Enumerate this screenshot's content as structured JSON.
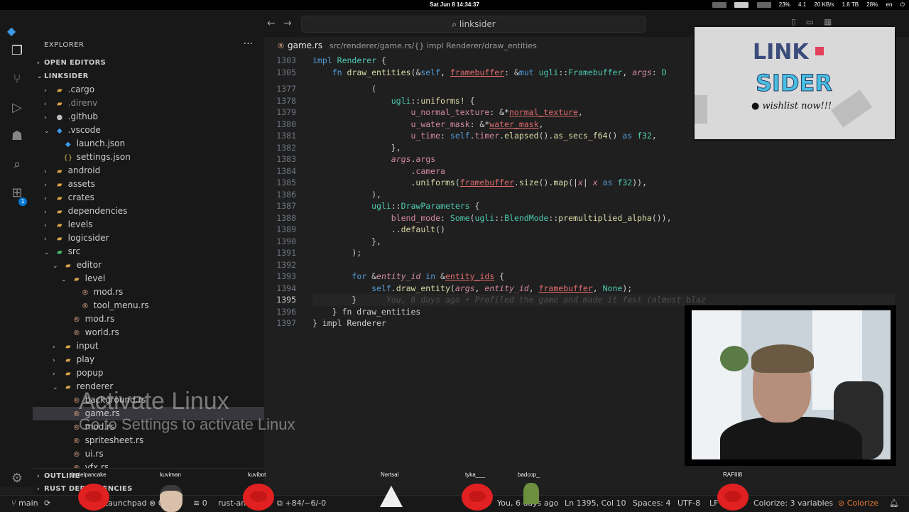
{
  "system_bar": {
    "clock": "Sat Jun 8 14:34:37",
    "tray": [
      "23%",
      "4.1",
      "20 KB/s",
      "1.8 TB",
      "28%",
      "en"
    ]
  },
  "titlebar": {
    "back_label": "←",
    "forward_label": "→",
    "search_text": "linksider"
  },
  "activity_bar": {
    "badge_count": "1"
  },
  "sidebar": {
    "header": "EXPLORER",
    "more": "···",
    "open_editors": "OPEN EDITORS",
    "project": "LINKSIDER",
    "items": [
      {
        "label": ".cargo",
        "type": "folder",
        "chev": "›",
        "indent": 0
      },
      {
        "label": ".direnv",
        "type": "folder",
        "chev": "›",
        "indent": 0,
        "dim": true
      },
      {
        "label": ".github",
        "type": "gh",
        "chev": "›",
        "indent": 0
      },
      {
        "label": ".vscode",
        "type": "vs",
        "chev": "⌄",
        "indent": 0
      },
      {
        "label": "launch.json",
        "type": "vs",
        "chev": "",
        "indent": 1
      },
      {
        "label": "settings.json",
        "type": "json",
        "chev": "",
        "indent": 1
      },
      {
        "label": "android",
        "type": "folder",
        "chev": "›",
        "indent": 0
      },
      {
        "label": "assets",
        "type": "folder",
        "chev": "›",
        "indent": 0
      },
      {
        "label": "crates",
        "type": "folder",
        "chev": "›",
        "indent": 0
      },
      {
        "label": "dependencies",
        "type": "folder",
        "chev": "›",
        "indent": 0
      },
      {
        "label": "levels",
        "type": "folder",
        "chev": "›",
        "indent": 0
      },
      {
        "label": "logicsider",
        "type": "folder",
        "chev": "›",
        "indent": 0
      },
      {
        "label": "src",
        "type": "src",
        "chev": "⌄",
        "indent": 0
      },
      {
        "label": "editor",
        "type": "folder",
        "chev": "⌄",
        "indent": 1
      },
      {
        "label": "level",
        "type": "folder",
        "chev": "⌄",
        "indent": 2
      },
      {
        "label": "mod.rs",
        "type": "rs",
        "chev": "",
        "indent": 3
      },
      {
        "label": "tool_menu.rs",
        "type": "rs",
        "chev": "",
        "indent": 3
      },
      {
        "label": "mod.rs",
        "type": "rs",
        "chev": "",
        "indent": 2
      },
      {
        "label": "world.rs",
        "type": "rs",
        "chev": "",
        "indent": 2
      },
      {
        "label": "input",
        "type": "folder",
        "chev": "›",
        "indent": 1
      },
      {
        "label": "play",
        "type": "folder",
        "chev": "›",
        "indent": 1
      },
      {
        "label": "popup",
        "type": "folder",
        "chev": "›",
        "indent": 1
      },
      {
        "label": "renderer",
        "type": "folder",
        "chev": "⌄",
        "indent": 1
      },
      {
        "label": "background.rs",
        "type": "rs",
        "chev": "",
        "indent": 2
      },
      {
        "label": "game.rs",
        "type": "rs",
        "chev": "",
        "indent": 2,
        "selected": true
      },
      {
        "label": "mod.rs",
        "type": "rs",
        "chev": "",
        "indent": 2
      },
      {
        "label": "spritesheet.rs",
        "type": "rs",
        "chev": "",
        "indent": 2
      },
      {
        "label": "ui.rs",
        "type": "rs",
        "chev": "",
        "indent": 2
      },
      {
        "label": "vfx.rs",
        "type": "rs",
        "chev": "",
        "indent": 2
      }
    ],
    "outline": "OUTLINE",
    "rust_deps": "RUST DEPENDENCIES"
  },
  "editor": {
    "tab_name": "game.rs",
    "breadcrumb": [
      "src/renderer/game.rs/",
      "{} impl Renderer/",
      "draw_entities"
    ],
    "lines": [
      {
        "n": "1303",
        "html": "<span class='kw'>impl</span> <span class='ty'>Renderer</span> {"
      },
      {
        "n": "1305",
        "html": "    <span class='kw'>fn</span> <span class='fn'>draw_entities</span>(&amp;<span class='kw'>self</span>, <span class='vr'>framebuffer</span>: &amp;<span class='kw'>mut</span> <span class='ty'>ugli</span>::<span class='ty'>Framebuffer</span>, <span class='it'>args</span>: <span class='ty'>D</span>"
      },
      {
        "n": "1377",
        "html": "            ("
      },
      {
        "n": "1378",
        "html": "                <span class='ty'>ugli</span>::<span class='fn'>uniforms!</span> {"
      },
      {
        "n": "1379",
        "html": "                    <span class='pr'>u_normal_texture</span>: &amp;*<span class='vr'>normal_texture</span>,"
      },
      {
        "n": "1380",
        "html": "                    <span class='pr'>u_water_mask</span>: &amp;*<span class='vr'>water_mask</span>,"
      },
      {
        "n": "1381",
        "html": "                    <span class='pr'>u_time</span>: <span class='kw'>self</span>.<span class='pr'>timer</span>.<span class='fn'>elapsed</span>().<span class='fn'>as_secs_f64</span>() <span class='kw'>as</span> <span class='ty'>f32</span>,"
      },
      {
        "n": "1382",
        "html": "                },"
      },
      {
        "n": "1383",
        "html": "                <span class='it'>args</span>.<span class='pr'>args</span>"
      },
      {
        "n": "1384",
        "html": "                    .<span class='pr'>camera</span>"
      },
      {
        "n": "1385",
        "html": "                    .<span class='fn'>uniforms</span>(<span class='vr'>framebuffer</span>.<span class='fn'>size</span>().<span class='fn'>map</span>(|<span class='it'>x</span>| <span class='it'>x</span> <span class='kw'>as</span> <span class='ty'>f32</span>)),"
      },
      {
        "n": "1386",
        "html": "            ),"
      },
      {
        "n": "1387",
        "html": "            <span class='ty'>ugli</span>::<span class='ty'>DrawParameters</span> {"
      },
      {
        "n": "1388",
        "html": "                <span class='pr'>blend_mode</span>: <span class='ty'>Some</span>(<span class='ty'>ugli</span>::<span class='ty'>BlendMode</span>::<span class='fn'>premultiplied_alpha</span>()),"
      },
      {
        "n": "1389",
        "html": "                ..<span class='fn'>default</span>()"
      },
      {
        "n": "1390",
        "html": "            },"
      },
      {
        "n": "1391",
        "html": "        );"
      },
      {
        "n": "1392",
        "html": ""
      },
      {
        "n": "1393",
        "html": "        <span class='kw'>for</span> &amp;<span class='it'>entity_id</span> <span class='kw'>in</span> &amp;<span class='vr'>entity_ids</span> {"
      },
      {
        "n": "1394",
        "html": "            <span class='kw'>self</span>.<span class='fn'>draw_entity</span>(<span class='it'>args</span>, <span class='it'>entity_id</span>, <span class='vr'>framebuffer</span>, <span class='ty'>None</span>);"
      },
      {
        "n": "1395",
        "html": "        }      <span class='blame'>You, 6 days ago • Profiled the game and made it fast (almost blaz</span>",
        "current": true
      },
      {
        "n": "1396",
        "html": "    } fn draw_entities"
      },
      {
        "n": "1397",
        "html": "} impl Renderer"
      }
    ]
  },
  "statusbar": {
    "branch": "main",
    "sync": "⟳",
    "errors": "0",
    "warnings": "0",
    "rust_analyzer": "rust-analyzer",
    "changes": "+84/~6/-0",
    "blame": "You, 6 days ago",
    "position": "Ln 1395, Col 10",
    "spaces": "Spaces: 4",
    "encoding": "UTF-8",
    "eol": "LF",
    "colorize_vars": "Colorize: 3 variables",
    "colorize": "Colorize",
    "launchpad": "Launchpad"
  },
  "overlay": {
    "logo_line1": "LINK",
    "logo_line2": "SIDER",
    "wishlist": "wishlist now!!!"
  },
  "watermark": {
    "line1": "Activate Linux",
    "line2": "Go to Settings to activate Linux"
  },
  "viewers": [
    "danielpancake",
    "kuviman",
    "kuvibot",
    "Nertsal",
    "tyka___",
    "badcop_",
    "RAFIII8"
  ],
  "colors": {
    "accent": "#0078d4",
    "colorize": "#e37933",
    "bird": "#e12121"
  }
}
